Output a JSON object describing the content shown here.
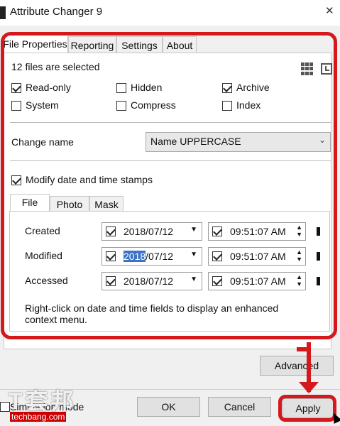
{
  "window": {
    "title": "Attribute Changer 9",
    "close_glyph": "✕"
  },
  "tabs": [
    "File Properties",
    "Reporting",
    "Settings",
    "About"
  ],
  "selection_text": "12 files are selected",
  "attributes": [
    {
      "label": "Read-only",
      "checked": true
    },
    {
      "label": "Hidden",
      "checked": false
    },
    {
      "label": "Archive",
      "checked": true
    },
    {
      "label": "System",
      "checked": false
    },
    {
      "label": "Compress",
      "checked": false
    },
    {
      "label": "Index",
      "checked": false
    }
  ],
  "change_name": {
    "label": "Change name",
    "value": "Name UPPERCASE"
  },
  "modify_dates": {
    "label": "Modify date and time stamps",
    "checked": true
  },
  "subtabs": [
    "File",
    "Photo",
    "Mask"
  ],
  "date_rows": [
    {
      "label": "Created",
      "date": "2018/07/12",
      "time": "09:51:07 AM"
    },
    {
      "label": "Modified",
      "date_highlight": "2018",
      "date_rest": "/07/12",
      "time": "09:51:07 AM"
    },
    {
      "label": "Accessed",
      "date": "2018/07/12",
      "time": "09:51:07 AM"
    }
  ],
  "hint": "Right-click on date and time fields to display an enhanced context menu.",
  "buttons": {
    "advanced": "Advanced",
    "ok": "OK",
    "cancel": "Cancel",
    "apply": "Apply"
  },
  "simulation_mode": {
    "label": "Simulation mode",
    "checked": false
  },
  "watermark": {
    "big": "T套邦",
    "small": "techbang.com"
  },
  "colors": {
    "annotation_red": "#d4181c",
    "highlight_blue": "#3b72c6"
  }
}
